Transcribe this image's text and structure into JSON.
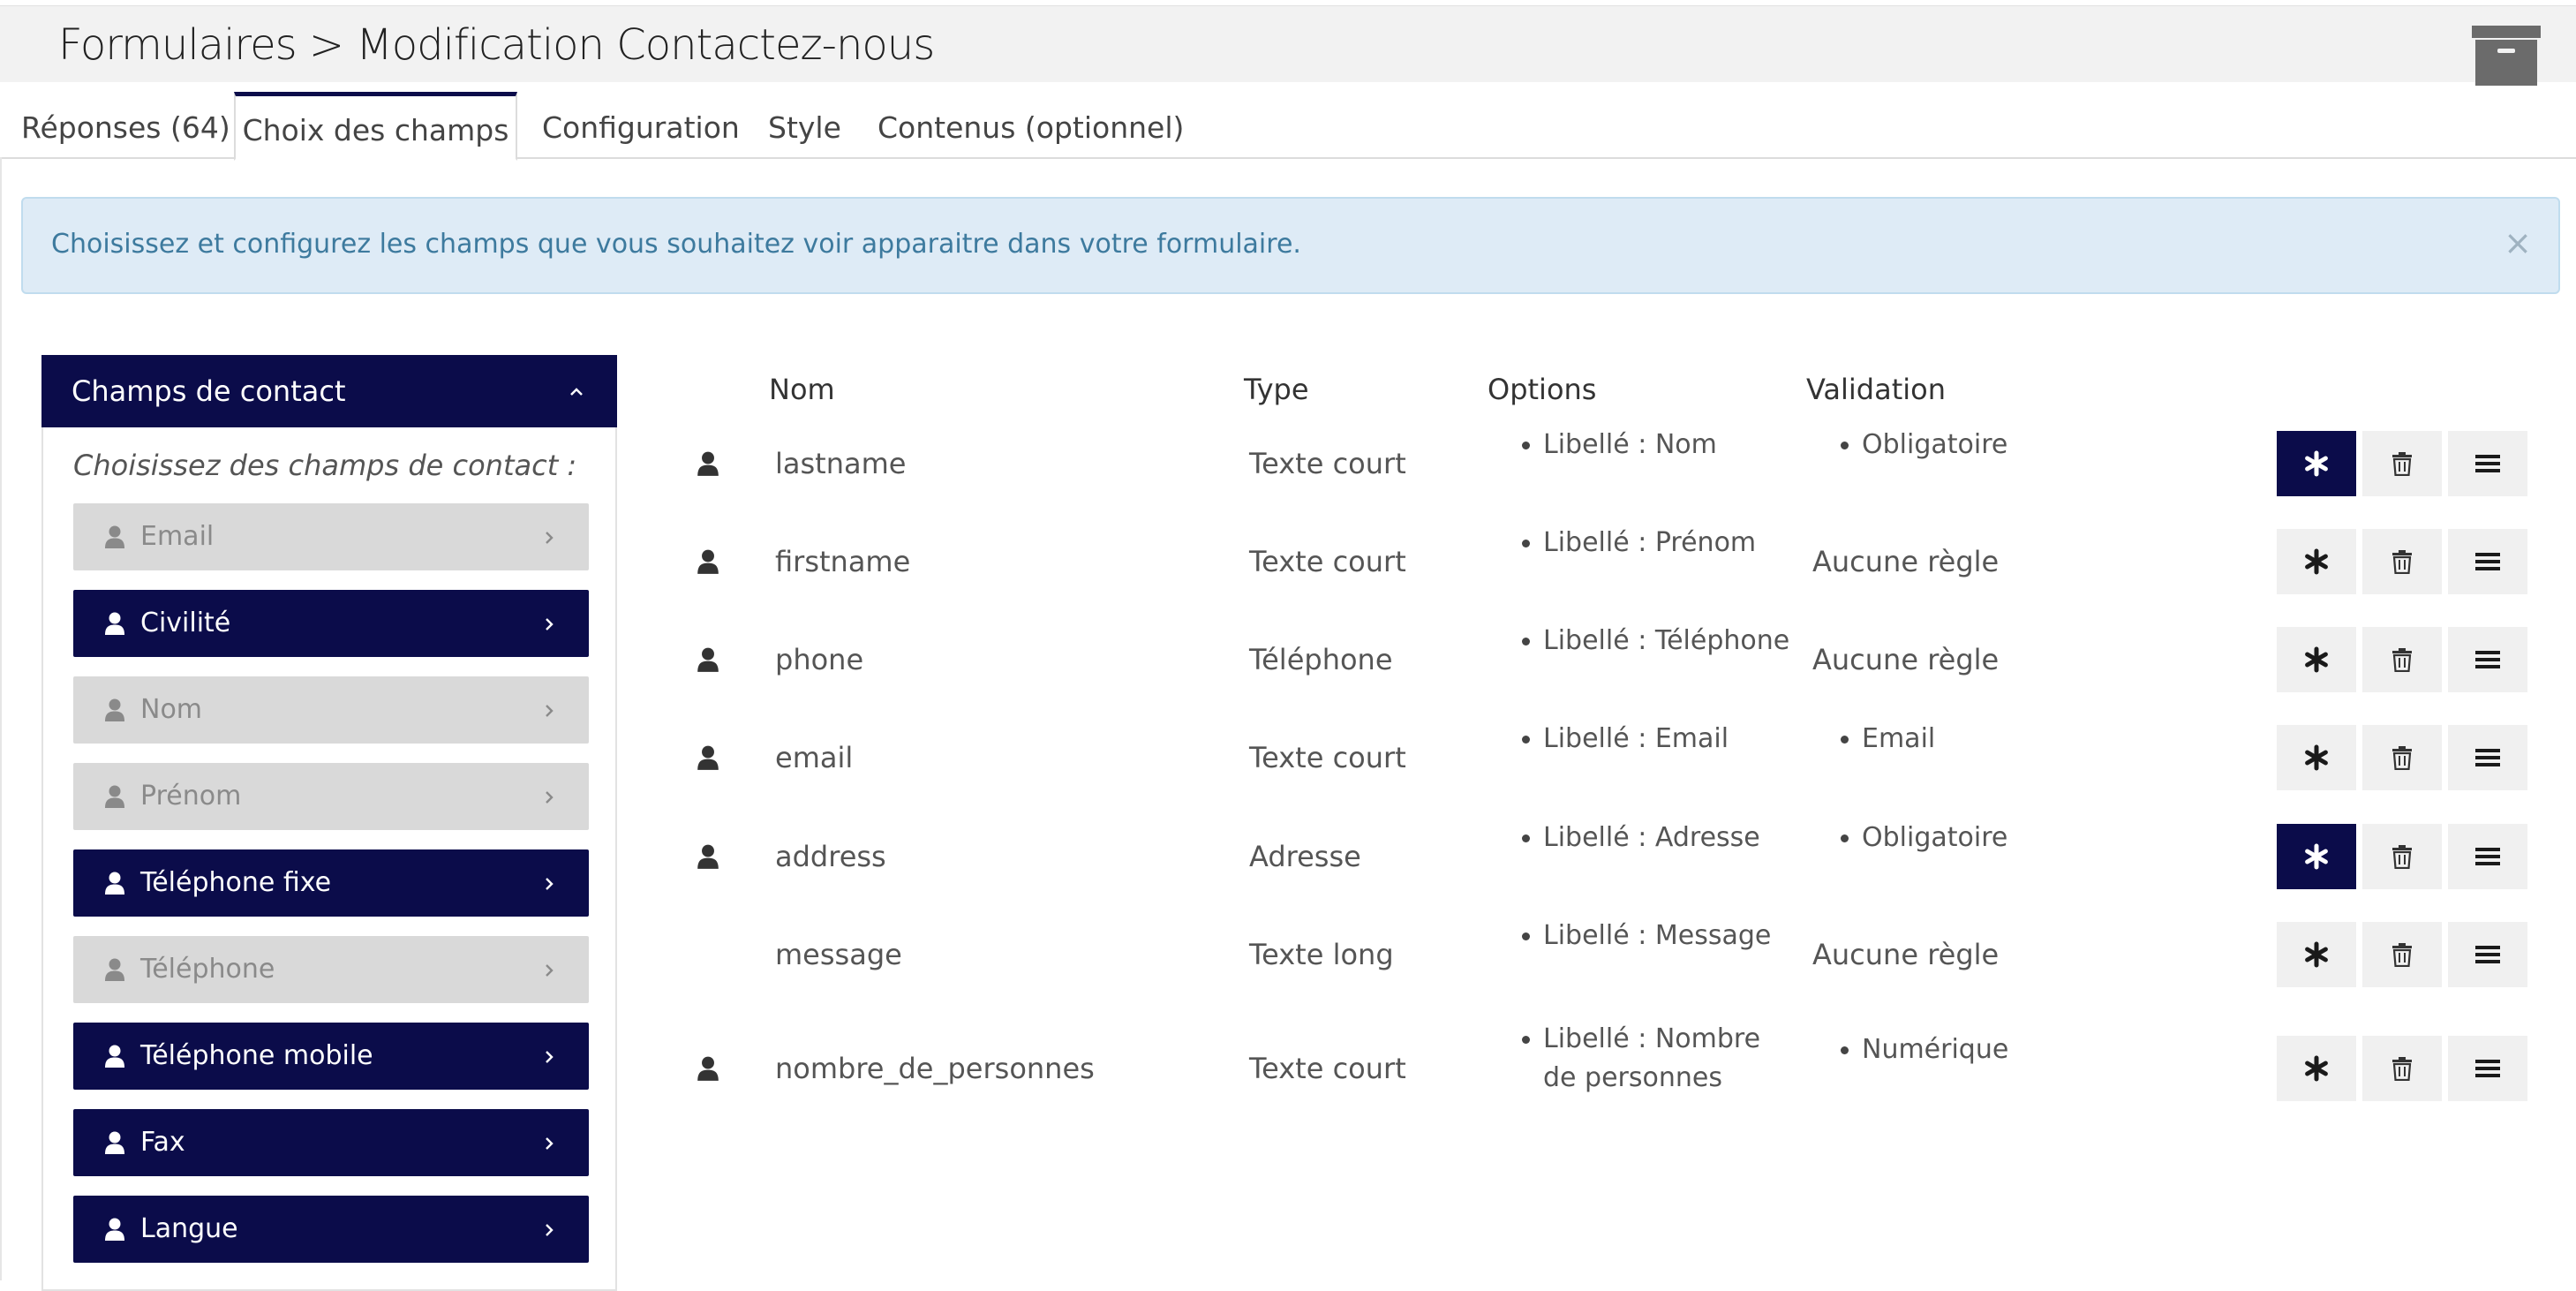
{
  "header": {
    "title": "Formulaires > Modification Contactez-nous"
  },
  "tabs": [
    {
      "label": "Réponses (64)"
    },
    {
      "label": "Choix des champs"
    },
    {
      "label": "Configuration"
    },
    {
      "label": "Style"
    },
    {
      "label": "Contenus (optionnel)"
    }
  ],
  "alert": {
    "text": "Choisissez et configurez les champs que vous souhaitez voir apparaitre dans votre formulaire.",
    "close": "×"
  },
  "panel": {
    "title": "Champs de contact",
    "hint": "Choisissez des champs de contact :",
    "fields": [
      {
        "label": "Email",
        "selected": false
      },
      {
        "label": "Civilité",
        "selected": true
      },
      {
        "label": "Nom",
        "selected": false
      },
      {
        "label": "Prénom",
        "selected": false
      },
      {
        "label": "Téléphone fixe",
        "selected": true
      },
      {
        "label": "Téléphone",
        "selected": false
      },
      {
        "label": "Téléphone mobile",
        "selected": true
      },
      {
        "label": "Fax",
        "selected": true
      },
      {
        "label": "Langue",
        "selected": true
      }
    ]
  },
  "table": {
    "headers": {
      "name": "Nom",
      "type": "Type",
      "options": "Options",
      "validation": "Validation"
    },
    "rows": [
      {
        "name": "lastname",
        "type": "Texte court",
        "options": [
          "Libellé : Nom"
        ],
        "validation": "Obligatoire",
        "validation_bullet": true,
        "required": true,
        "contact_icon": true
      },
      {
        "name": "firstname",
        "type": "Texte court",
        "options": [
          "Libellé : Prénom"
        ],
        "validation": "Aucune règle",
        "validation_bullet": false,
        "required": false,
        "contact_icon": true
      },
      {
        "name": "phone",
        "type": "Téléphone",
        "options": [
          "Libellé : Téléphone"
        ],
        "validation": "Aucune règle",
        "validation_bullet": false,
        "required": false,
        "contact_icon": true
      },
      {
        "name": "email",
        "type": "Texte court",
        "options": [
          "Libellé : Email"
        ],
        "validation": "Email",
        "validation_bullet": true,
        "required": false,
        "contact_icon": true
      },
      {
        "name": "address",
        "type": "Adresse",
        "options": [
          "Libellé : Adresse"
        ],
        "validation": "Obligatoire",
        "validation_bullet": true,
        "required": true,
        "contact_icon": true
      },
      {
        "name": "message",
        "type": "Texte long",
        "options": [
          "Libellé : Message"
        ],
        "validation": "Aucune règle",
        "validation_bullet": false,
        "required": false,
        "contact_icon": false
      },
      {
        "name": "nombre_de_personnes",
        "type": "Texte court",
        "options": [
          "Libellé : Nombre",
          "de personnes"
        ],
        "validation": "Numérique",
        "validation_bullet": true,
        "required": false,
        "contact_icon": true
      }
    ]
  },
  "icons": {
    "archive": "archive-box-icon",
    "user": "user-icon",
    "required": "asterisk-icon",
    "delete": "trash-icon",
    "reorder": "hamburger-icon",
    "chevron_up": "chevron-up-icon",
    "chevron_right": "chevron-right-icon"
  },
  "colors": {
    "primary": "#0b0c4a",
    "alert_bg": "#deebf6",
    "alert_text": "#3d7a9e",
    "inactive_field": "#d9d9d9"
  }
}
